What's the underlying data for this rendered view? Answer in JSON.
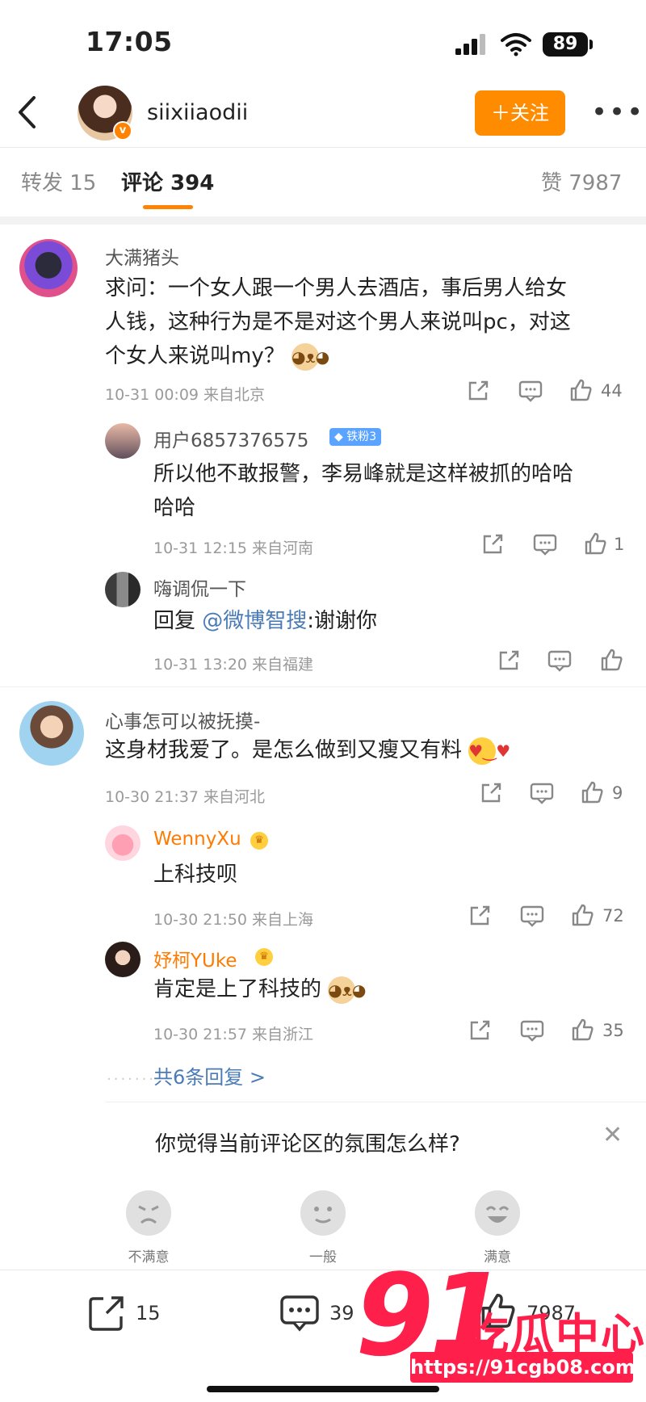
{
  "status_bar": {
    "time": "17:05",
    "battery": "89"
  },
  "header": {
    "username": "siixiiaodii",
    "follow_label": "＋关注",
    "more": "•••"
  },
  "tabs": [
    {
      "label": "转发 15"
    },
    {
      "label": "评论 394"
    },
    {
      "label": "赞 7987"
    }
  ],
  "comments": [
    {
      "user": "大满猪头",
      "text_line1": "求问：一个女人跟一个男人去酒店，事后男人给女",
      "text_line2": "人钱，这种行为是不是对这个男人来说叫pc，对这",
      "text_line3": "个女人来说叫my？",
      "meta": "10-31 00:09  来自北京",
      "likes": "44",
      "replies": [
        {
          "user": "用户6857376575",
          "badge": "铁粉3",
          "text_line1": "所以他不敢报警，李易峰就是这样被抓的哈哈",
          "text_line2": "哈哈",
          "meta": "10-31 12:15  来自河南",
          "likes": "1"
        },
        {
          "user": "嗨调侃一下",
          "reply_prefix": "回复",
          "mention": "@微博智搜",
          "text": ":谢谢你",
          "meta": "10-31 13:20  来自福建",
          "likes": ""
        }
      ]
    },
    {
      "user": "心事怎可以被抚摸-",
      "text": "这身材我爱了。是怎么做到又瘦又有料",
      "meta": "10-30 21:37  来自河北",
      "likes": "9",
      "replies": [
        {
          "user": "WennyXu",
          "text": "上科技呗",
          "meta": "10-30 21:50  来自上海",
          "likes": "72"
        },
        {
          "user": "妤柯YUke",
          "text": "肯定是上了科技的",
          "meta": "10-30 21:57  来自浙江",
          "likes": "35"
        }
      ],
      "more_replies": "共6条回复 >"
    }
  ],
  "feedback": {
    "question": "你觉得当前评论区的氛围怎么样?",
    "options": [
      {
        "label": "不满意"
      },
      {
        "label": "一般"
      },
      {
        "label": "满意"
      }
    ]
  },
  "bottom_bar": {
    "repost_count": "15",
    "comment_count": "39",
    "like_count": "7987"
  },
  "watermark": {
    "number": "91",
    "title": "吃瓜中心",
    "url": "https://91cgb08.com"
  }
}
